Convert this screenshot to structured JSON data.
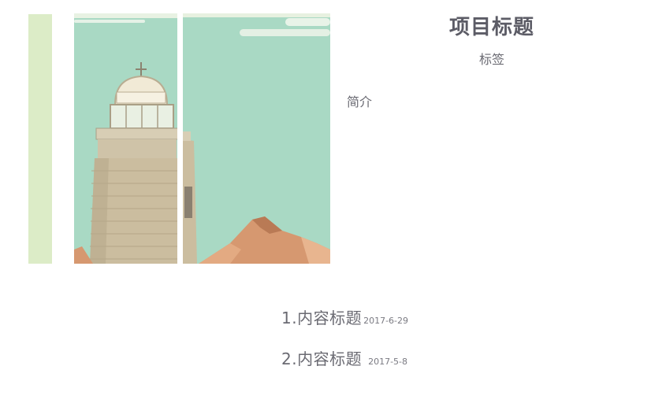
{
  "project": {
    "title": "项目标题",
    "tag": "标签",
    "intro": "简介"
  },
  "content_items": [
    {
      "title": "1.内容标题",
      "date": "2017-6-29"
    },
    {
      "title": "2.内容标题",
      "date": "2017-5-8"
    }
  ],
  "colors": {
    "side_strip": "#dcecc7",
    "sky": "#a9d9c4",
    "tower": "#cfc3a8",
    "mountain": "#d69870",
    "text": "#6a6a72"
  },
  "image": {
    "subject": "lighthouse-illustration"
  }
}
